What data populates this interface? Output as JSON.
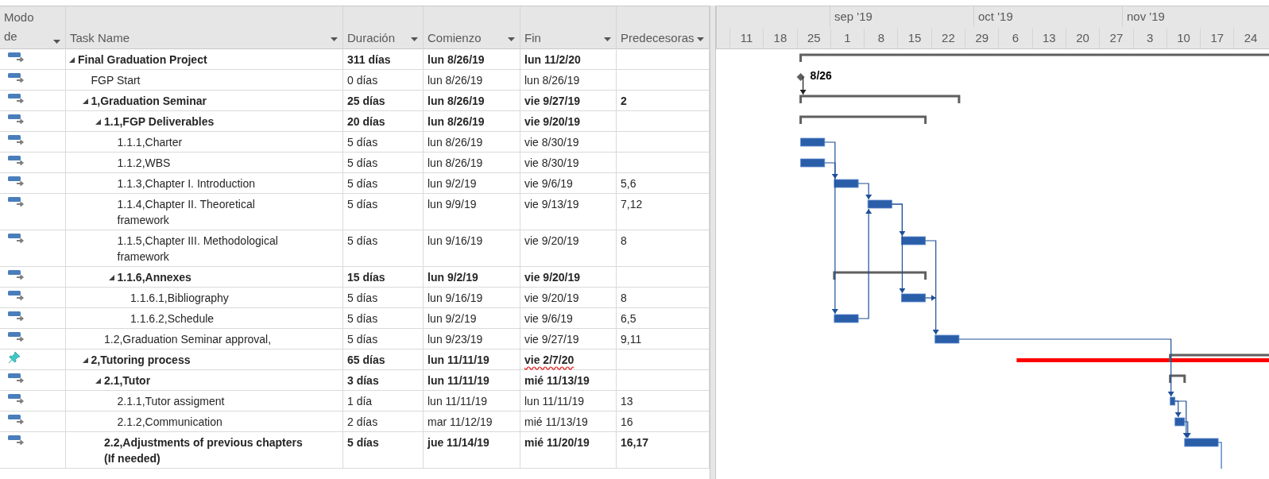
{
  "table": {
    "columns": [
      {
        "label": "Modo de"
      },
      {
        "label": "Task Name"
      },
      {
        "label": "Duración"
      },
      {
        "label": "Comienzo"
      },
      {
        "label": "Fin"
      },
      {
        "label": "Predecesoras"
      }
    ],
    "rows": [
      {
        "manually_scheduled": false,
        "kind": "summary",
        "bold": true,
        "expanded": true,
        "name": "Final Graduation Project",
        "duration": "311 días",
        "start": "lun 8/26/19",
        "finish": "lun 11/2/20",
        "finish_flagged": false,
        "children": [
          {
            "manually_scheduled": false,
            "kind": "milestone",
            "bold": false,
            "name": "FGP Start",
            "duration": "0 días",
            "start": "lun 8/26/19",
            "finish": "lun 8/26/19",
            "finish_flagged": false,
            "gantt_label": "8/26"
          },
          {
            "manually_scheduled": false,
            "kind": "summary",
            "bold": true,
            "expanded": true,
            "name": "1,Graduation Seminar",
            "duration": "25 días",
            "start": "lun 8/26/19",
            "finish": "vie 9/27/19",
            "finish_flagged": false,
            "predecessors": "2",
            "children": [
              {
                "manually_scheduled": false,
                "kind": "summary",
                "bold": true,
                "expanded": true,
                "name": "1.1,FGP Deliverables",
                "duration": "20 días",
                "start": "lun 8/26/19",
                "finish": "vie 9/20/19",
                "finish_flagged": false,
                "children": [
                  {
                    "manually_scheduled": false,
                    "kind": "task",
                    "bold": false,
                    "name": "1.1.1,Charter",
                    "duration": "5 días",
                    "start": "lun 8/26/19",
                    "finish": "vie 8/30/19",
                    "finish_flagged": false
                  },
                  {
                    "manually_scheduled": false,
                    "kind": "task",
                    "bold": false,
                    "name": "1.1.2,WBS",
                    "duration": "5 días",
                    "start": "lun 8/26/19",
                    "finish": "vie 8/30/19",
                    "finish_flagged": false
                  },
                  {
                    "manually_scheduled": false,
                    "kind": "task",
                    "bold": false,
                    "name": "1.1.3,Chapter I. Introduction",
                    "duration": "5 días",
                    "start": "lun 9/2/19",
                    "finish": "vie 9/6/19",
                    "finish_flagged": false,
                    "predecessors": "5,6"
                  },
                  {
                    "manually_scheduled": false,
                    "kind": "task",
                    "bold": false,
                    "name": "1.1.4,Chapter II. Theoretical framework",
                    "duration": "5 días",
                    "start": "lun 9/9/19",
                    "finish": "vie 9/13/19",
                    "finish_flagged": false,
                    "predecessors": "7,12"
                  },
                  {
                    "manually_scheduled": false,
                    "kind": "task",
                    "bold": false,
                    "name": "1.1.5,Chapter III. Methodological framework",
                    "duration": "5 días",
                    "start": "lun 9/16/19",
                    "finish": "vie 9/20/19",
                    "finish_flagged": false,
                    "predecessors": "8"
                  },
                  {
                    "manually_scheduled": false,
                    "kind": "summary",
                    "bold": true,
                    "expanded": true,
                    "name": "1.1.6,Annexes",
                    "duration": "15 días",
                    "start": "lun 9/2/19",
                    "finish": "vie 9/20/19",
                    "finish_flagged": false,
                    "children": [
                      {
                        "manually_scheduled": false,
                        "kind": "task",
                        "bold": false,
                        "name": "1.1.6.1,Bibliography",
                        "duration": "5 días",
                        "start": "lun 9/16/19",
                        "finish": "vie 9/20/19",
                        "finish_flagged": false,
                        "predecessors": "8"
                      },
                      {
                        "manually_scheduled": false,
                        "kind": "task",
                        "bold": false,
                        "name": "1.1.6.2,Schedule",
                        "duration": "5 días",
                        "start": "lun 9/2/19",
                        "finish": "vie 9/6/19",
                        "finish_flagged": false,
                        "predecessors": "6,5"
                      }
                    ]
                  }
                ]
              },
              {
                "manually_scheduled": false,
                "kind": "task",
                "bold": false,
                "name": "1.2,Graduation Seminar approval,",
                "duration": "5 días",
                "start": "lun 9/23/19",
                "finish": "vie 9/27/19",
                "finish_flagged": false,
                "predecessors": "9,11"
              }
            ]
          },
          {
            "manually_scheduled": true,
            "kind": "summary",
            "bold": true,
            "expanded": true,
            "name": "2,Tutoring process",
            "duration": "65 días",
            "start": "lun 11/11/19",
            "finish": "vie 2/7/20",
            "finish_flagged": true,
            "children": [
              {
                "manually_scheduled": false,
                "kind": "summary",
                "bold": true,
                "expanded": true,
                "name": "2.1,Tutor",
                "duration": "3 días",
                "start": "lun 11/11/19",
                "finish": "mié 11/13/19",
                "finish_flagged": false,
                "children": [
                  {
                    "manually_scheduled": false,
                    "kind": "task",
                    "bold": false,
                    "name": "2.1.1,Tutor assigment",
                    "duration": "1 día",
                    "start": "lun 11/11/19",
                    "finish": "lun 11/11/19",
                    "finish_flagged": false,
                    "predecessors": "13"
                  },
                  {
                    "manually_scheduled": false,
                    "kind": "task",
                    "bold": false,
                    "name": "2.1.2,Communication",
                    "duration": "2 días",
                    "start": "mar 11/12/19",
                    "finish": "mié 11/13/19",
                    "finish_flagged": false,
                    "predecessors": "16"
                  }
                ]
              },
              {
                "manually_scheduled": false,
                "kind": "task",
                "bold": true,
                "name": "2.2,Adjustments of previous chapters (If needed)",
                "duration": "5 días",
                "start": "jue 11/14/19",
                "finish": "mié 11/20/19",
                "finish_flagged": false,
                "predecessors": "16,17"
              }
            ]
          }
        ]
      }
    ]
  },
  "timeline": {
    "months": [
      "sep '19",
      "oct '19",
      "nov '19"
    ],
    "weeks": [
      "11",
      "18",
      "25",
      "1",
      "8",
      "15",
      "22",
      "29",
      "6",
      "13",
      "20",
      "27",
      "3",
      "10",
      "17",
      "24"
    ]
  }
}
